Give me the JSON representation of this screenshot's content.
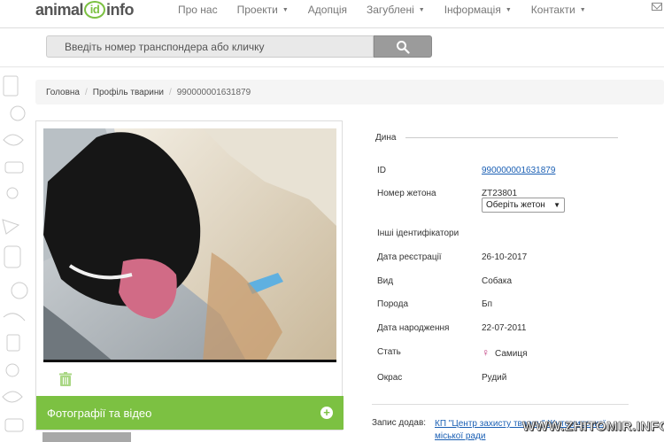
{
  "brand": {
    "logo_left": "animal",
    "logo_id": "id",
    "logo_right": "info"
  },
  "nav": {
    "items": [
      {
        "label": "Про нас",
        "dropdown": false
      },
      {
        "label": "Проекти",
        "dropdown": true
      },
      {
        "label": "Адопція",
        "dropdown": false
      },
      {
        "label": "Загублені",
        "dropdown": true
      },
      {
        "label": "Інформація",
        "dropdown": true
      },
      {
        "label": "Контакти",
        "dropdown": true
      }
    ]
  },
  "search": {
    "placeholder": "Введіть номер транспондера або кличку",
    "icon": "search-icon"
  },
  "breadcrumb": {
    "home": "Головна",
    "profile": "Профіль тварини",
    "current": "990000001631879"
  },
  "media": {
    "section_label": "Фотографії та відео",
    "trash_icon": "trash-icon",
    "add_icon": "plus-circle-icon"
  },
  "animal": {
    "name": "Дина",
    "fields": {
      "id_label": "ID",
      "id_value": "990000001631879",
      "token_label": "Номер жетона",
      "token_value": "ZT23801",
      "token_select": "Оберіть жетон",
      "other_ids_label": "Інші ідентифікатори",
      "reg_date_label": "Дата реєстрації",
      "reg_date_value": "26-10-2017",
      "species_label": "Вид",
      "species_value": "Собака",
      "breed_label": "Порода",
      "breed_value": "Бп",
      "birth_label": "Дата народження",
      "birth_value": "22-07-2011",
      "sex_label": "Стать",
      "sex_value": "Самиця",
      "color_label": "Окрас",
      "color_value": "Рудий"
    },
    "added_by_label": "Запис додав:",
    "added_by_value": "КП \"Центр захисту тварин\" Житомирської міської ради"
  },
  "watermark": "WWW.ZHITOMIR.INFO",
  "colors": {
    "accent_green": "#7cc142",
    "link_blue": "#1a5fb4",
    "female_pink": "#c0397e"
  }
}
